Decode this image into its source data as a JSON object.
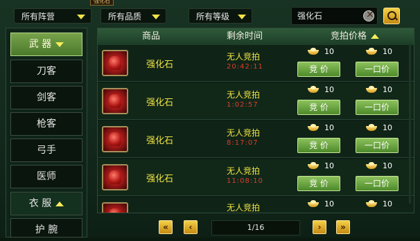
{
  "tab_tag": "强化石",
  "filters": {
    "camp": "所有阵营",
    "quality": "所有品质",
    "level": "所有等级",
    "search_value": "强化石"
  },
  "sidebar": {
    "items": [
      {
        "label": "武 器",
        "state": "active-expanded"
      },
      {
        "label": "刀客"
      },
      {
        "label": "剑客"
      },
      {
        "label": "枪客"
      },
      {
        "label": "弓手"
      },
      {
        "label": "医师"
      },
      {
        "label": "衣 服",
        "state": "collapsed-group"
      },
      {
        "label": "护 腕"
      }
    ]
  },
  "table": {
    "headers": {
      "item": "商品",
      "time": "剩余时间",
      "price": "竞拍价格"
    },
    "rows": [
      {
        "name": "强化石",
        "status": "无人竞拍",
        "timer": "20:42:11",
        "bid_price": "10",
        "buyout_price": "10",
        "bid_label": "竞 价",
        "buyout_label": "一口价"
      },
      {
        "name": "强化石",
        "status": "无人竞拍",
        "timer": "1:02:57",
        "bid_price": "10",
        "buyout_price": "10",
        "bid_label": "竞 价",
        "buyout_label": "一口价"
      },
      {
        "name": "强化石",
        "status": "无人竞拍",
        "timer": "8:17:07",
        "bid_price": "10",
        "buyout_price": "10",
        "bid_label": "竞 价",
        "buyout_label": "一口价"
      },
      {
        "name": "强化石",
        "status": "无人竞拍",
        "timer": "11:08:10",
        "bid_price": "10",
        "buyout_price": "10",
        "bid_label": "竞 价",
        "buyout_label": "一口价"
      },
      {
        "name": "",
        "status": "无人竞拍",
        "timer": "",
        "bid_price": "10",
        "buyout_price": "10",
        "bid_label": "",
        "buyout_label": ""
      }
    ]
  },
  "pager": {
    "first": "«",
    "prev": "‹",
    "page": "1/16",
    "next": "›",
    "last": "»"
  },
  "colors": {
    "accent_gold": "#f0e243",
    "timer_red": "#e03b2a",
    "button_green": "#6aa83f"
  }
}
